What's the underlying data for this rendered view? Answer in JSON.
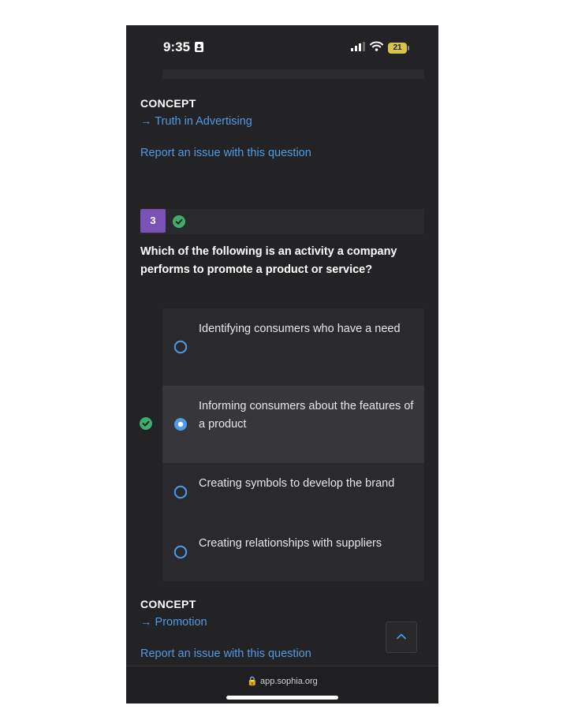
{
  "status_bar": {
    "time": "9:35",
    "battery_level": "21",
    "icons": [
      "person-badge-icon",
      "cellular-signal-icon",
      "wifi-icon",
      "battery-icon"
    ]
  },
  "concept_1": {
    "heading": "CONCEPT",
    "link_text": "→ Truth in Advertising",
    "report_text": "Report an issue with this question"
  },
  "question": {
    "number": "3",
    "status": "correct",
    "text": "Which of the following is an activity a company performs to promote a product or service?",
    "options": [
      {
        "text": "Identifying consumers who have a need",
        "selected": false
      },
      {
        "text": "Informing consumers about the features of a product",
        "selected": true
      },
      {
        "text": "Creating symbols to develop the brand",
        "selected": false
      },
      {
        "text": "Creating relationships with suppliers",
        "selected": false
      }
    ]
  },
  "concept_2": {
    "heading": "CONCEPT",
    "link_text": "→ Promotion",
    "report_text": "Report an issue with this question"
  },
  "browser": {
    "url": "🔒 app.sophia.org"
  },
  "colors": {
    "background": "#232326",
    "link": "#4f9be6",
    "question_badge": "#7a52b6",
    "correct": "#3fae6a",
    "radio": "#4f9be6"
  }
}
